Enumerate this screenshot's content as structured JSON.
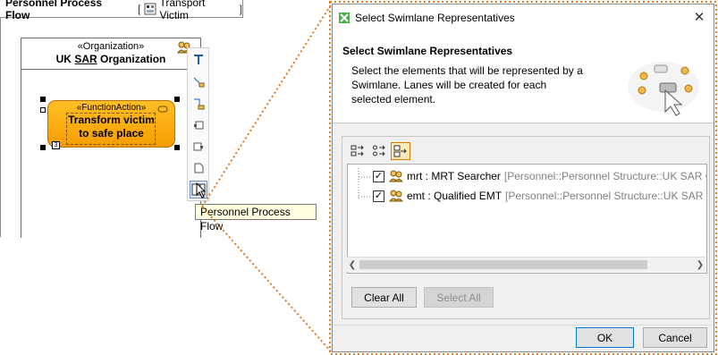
{
  "diagram": {
    "title": "Personnel Process Flow",
    "owner_label": "Transport Victim",
    "owner_open_bracket": "[",
    "owner_close_bracket": "]",
    "lane": {
      "stereotype": "«Organization»",
      "name_prefix": "UK",
      "name_underlined": "SAR",
      "name_suffix": "Organization"
    },
    "action": {
      "stereotype": "«FunctionAction»",
      "name_line1": "Transform victim",
      "name_line2": "to safe place",
      "pin_label": "3"
    },
    "tooltip": "Personnel Process Flow"
  },
  "dialog": {
    "title": "Select Swimlane Representatives",
    "banner_title": "Select Swimlane Representatives",
    "banner_description": "Select the elements that will be represented by a Swimlane. Lanes will be created for each selected element.",
    "tree_rows": [
      {
        "name": "mrt : MRT Searcher",
        "path": "[Personnel::Personnel Structure::UK SAR Orga",
        "checked": true
      },
      {
        "name": "emt : Qualified EMT",
        "path": "[Personnel::Personnel Structure::UK SAR Org",
        "checked": true
      }
    ],
    "buttons": {
      "clear_all": "Clear All",
      "select_all": "Select All",
      "ok": "OK",
      "cancel": "Cancel"
    }
  },
  "colors": {
    "action_fill": "#f5a300",
    "callout": "#e07a20",
    "dialog_bg": "#f0f0f0"
  }
}
